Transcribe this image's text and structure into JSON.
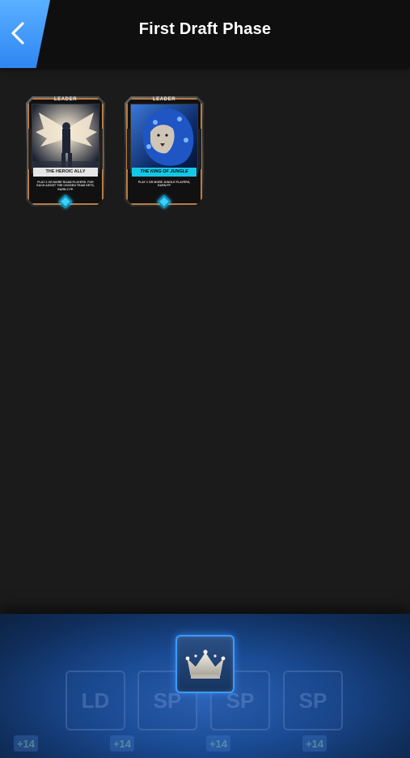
{
  "header": {
    "title": "First Draft Phase",
    "back_icon": "chevron-left-icon"
  },
  "cards": [
    {
      "tag": "LEADER",
      "name": "THE HEROIC ALLY",
      "description": "PLAY 2 OR MORE ROAM PLAYERS. FOR EACH ASSIST THE CHOSEN TEAM GETS, EARN 2 FP.",
      "name_color": "#e6e6e6"
    },
    {
      "tag": "LEADER",
      "name": "THE KING OF JUNGLE",
      "description": "PLAY 2 OR MORE JUNGLE PLAYERS, EARN FP",
      "name_color": "#15c7e6"
    }
  ],
  "bottom": {
    "crown_button_icon": "crown-icon",
    "slots": [
      "LD",
      "SP",
      "SP",
      "SP"
    ],
    "points": [
      "+14",
      "+14",
      "+14",
      "+14"
    ],
    "accent": "#3a9bff"
  }
}
